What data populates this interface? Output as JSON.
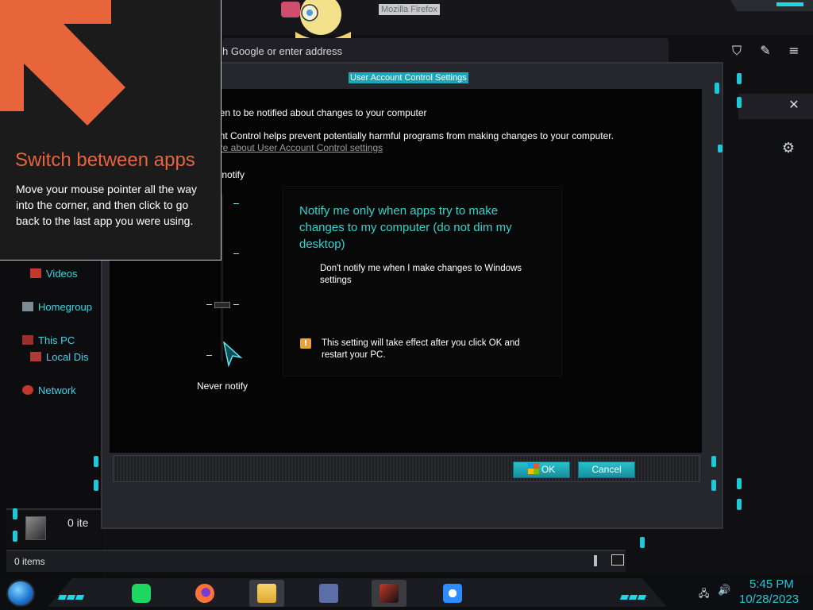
{
  "firefox": {
    "window_title": "Mozilla Firefox",
    "url_placeholder": "Search with Google or enter address",
    "url_visible_text": "h Google or enter address"
  },
  "explorer": {
    "nav_items": [
      {
        "label": "Videos",
        "icon": "video-icon"
      },
      {
        "label": "Homegroup",
        "icon": "homegroup-icon"
      },
      {
        "label": "This PC",
        "icon": "computer-icon"
      },
      {
        "label": "Local Dis",
        "icon": "drive-icon"
      },
      {
        "label": "Network",
        "icon": "network-icon"
      }
    ],
    "details_count": "0 ite",
    "status": "0 items"
  },
  "uac": {
    "title": "User Account Control Settings",
    "heading": "hen to be notified about changes to your computer",
    "description": "unt Control helps prevent potentially harmful programs from making changes to your computer.",
    "link": "ore about User Account Control settings",
    "slider_top_label": "s notify",
    "slider_bottom_label": "Never notify",
    "slider_level": "3 of 4",
    "panel_title": "Notify me only when apps try to make changes to my computer (do not dim my desktop)",
    "panel_sub": "Don't notify me when I make changes to Windows settings",
    "panel_note": "This setting will take effect after you click OK and restart your PC.",
    "ok_label": "OK",
    "cancel_label": "Cancel"
  },
  "tip": {
    "title": "Switch between apps",
    "body": "Move your mouse pointer all the way into the corner, and then click to go back to the last app you were using.",
    "accent": "#e8643a"
  },
  "taskbar": {
    "apps": [
      "spotify-icon",
      "firefox-icon",
      "file-explorer-icon",
      "app-window-icon",
      "game-icon",
      "settings-sun-icon"
    ],
    "time": "5:45 PM",
    "date": "10/28/2023",
    "accent": "#1fd6e6"
  }
}
